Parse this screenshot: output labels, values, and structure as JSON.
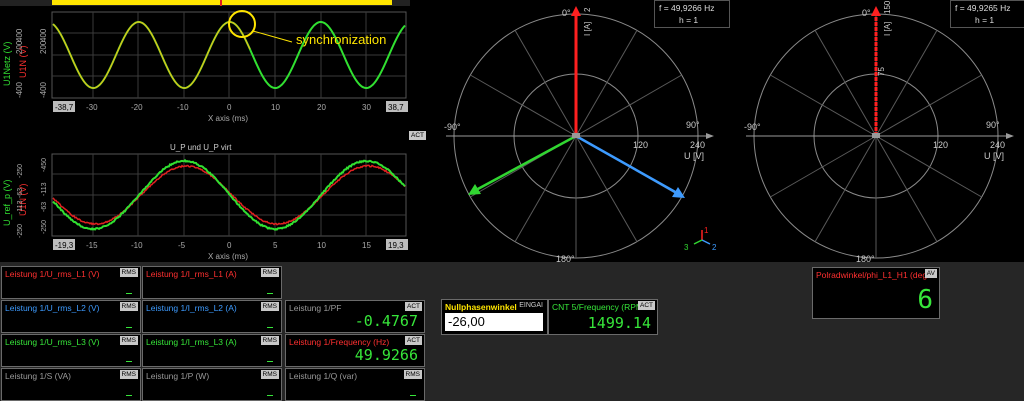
{
  "scope1": {
    "ylabel_left": "U1Netz (V)",
    "ylabel_right": "U1N (V)",
    "xlabel": "X axis (ms)",
    "annotation": "synchronization",
    "yticks_left": [
      "200",
      "400",
      "-400"
    ],
    "yticks_right": [
      "200",
      "400",
      "-400"
    ],
    "xtick_min": "-38,7",
    "xtick_max": "38,7",
    "xticks": [
      "-30",
      "-20",
      "-10",
      "0",
      "10",
      "20",
      "30"
    ]
  },
  "scope2": {
    "title": "U_P und U_P virt",
    "act": "ACT",
    "ylabel_left": "U_ref_p (V)",
    "ylabel_right": "U1N (V)",
    "xlabel": "X axis (ms)",
    "yticks_left": [
      "-250",
      "-63",
      "-113",
      "-250",
      "-450"
    ],
    "yticks_right": [
      "-450",
      "-113",
      "-63",
      "-250"
    ],
    "xtick_min": "-19,3",
    "xtick_max": "19,3",
    "xticks": [
      "-15",
      "-10",
      "-5",
      "0",
      "5",
      "10",
      "15"
    ]
  },
  "polar1": {
    "freq": "f = 49,9266 Hz",
    "h": "h = 1",
    "top_label": "0°",
    "left_label": "-90°",
    "right_label": "90°",
    "bottom_label": "180°",
    "unit_top": "I [A]",
    "top_tick": "2",
    "r1": "120",
    "r2": "240",
    "unit": "U [V]",
    "axis1": "1",
    "axis2": "2",
    "axis3": "3"
  },
  "polar2": {
    "freq": "f = 49,9265 Hz",
    "h": "h = 1",
    "top_label": "0°",
    "left_label": "-90°",
    "right_label": "90°",
    "bottom_label": "180°",
    "unit_top": "I [A]",
    "top_tick": "150",
    "mid_tick": "75",
    "r1": "120",
    "r2": "240",
    "unit": "U [V]"
  },
  "measures": [
    {
      "label": "Leistung 1/U_rms_L1 (V)",
      "tag": "RMS",
      "value": "–",
      "color": "#ff3030"
    },
    {
      "label": "Leistung 1/I_rms_L1 (A)",
      "tag": "RMS",
      "value": "–",
      "color": "#ff3030"
    },
    {
      "label": "Leistung 1/U_rms_L2 (V)",
      "tag": "RMS",
      "value": "–",
      "color": "#3d9bff"
    },
    {
      "label": "Leistung 1/I_rms_L2 (A)",
      "tag": "RMS",
      "value": "–",
      "color": "#3d9bff"
    },
    {
      "label": "Leistung 1/PF",
      "tag": "ACT",
      "value": "-0.4767",
      "color": "#9a9a9a"
    },
    {
      "label": "Leistung 1/U_rms_L3 (V)",
      "tag": "RMS",
      "value": "–",
      "color": "#37e63a"
    },
    {
      "label": "Leistung 1/I_rms_L3 (A)",
      "tag": "RMS",
      "value": "–",
      "color": "#37e63a"
    },
    {
      "label": "Leistung 1/Frequency (Hz)",
      "tag": "ACT",
      "value": "49.9266",
      "color": "#ff3030"
    },
    {
      "label": "Leistung 1/S (VA)",
      "tag": "RMS",
      "value": "–",
      "color": "#9a9a9a"
    },
    {
      "label": "Leistung 1/P (W)",
      "tag": "RMS",
      "value": "–",
      "color": "#9a9a9a"
    },
    {
      "label": "Leistung 1/Q (var)",
      "tag": "RMS",
      "value": "–",
      "color": "#9a9a9a"
    }
  ],
  "nullphase": {
    "label": "Nullphasenwinkel",
    "tag": "EINGAI",
    "value": "-26,00"
  },
  "cnt": {
    "label": "CNT 5/Frequency (RPM",
    "tag": "ACT",
    "value": "1499.14"
  },
  "polrad": {
    "label": "Polradwinkel/phi_L1_H1 (deg",
    "tag": "AV",
    "value": "6"
  }
}
